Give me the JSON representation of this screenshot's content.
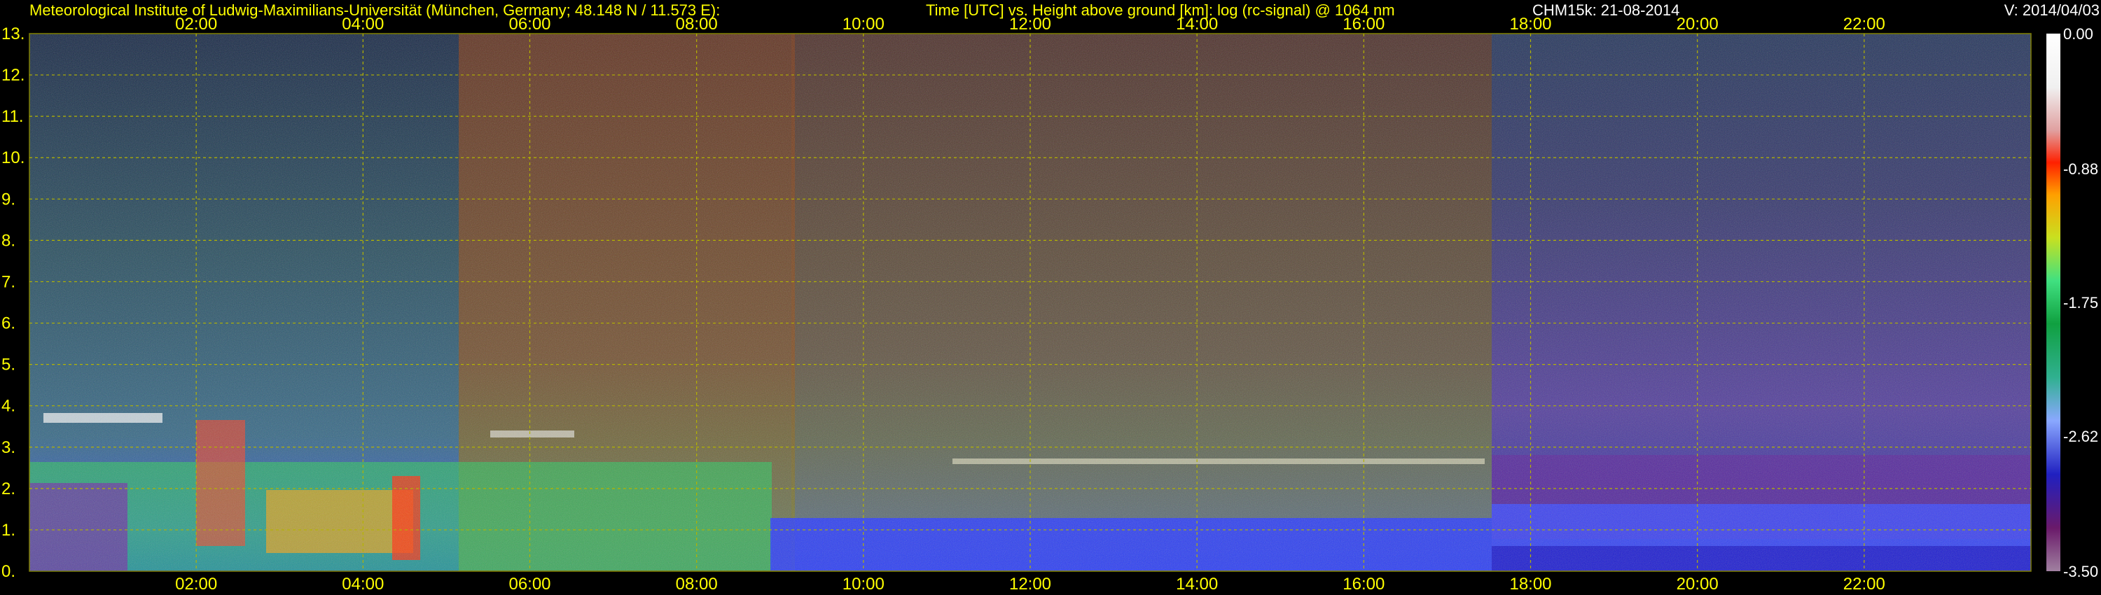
{
  "header": {
    "institute": "Meteorological Institute of Ludwig-Maximilians-Universität (München, Germany; 48.148 N / 11.573 E):",
    "description": "Time [UTC] vs. Height above ground [km]: log (rc-signal) @ 1064 nm",
    "instrument_date": "CHM15k: 21-08-2014",
    "version": "V: 2014/04/03"
  },
  "chart_data": {
    "type": "heatmap",
    "title": "Time [UTC] vs. Height above ground [km]: log (rc-signal) @ 1064 nm",
    "x_ticks": [
      "02:00",
      "04:00",
      "06:00",
      "08:00",
      "10:00",
      "12:00",
      "14:00",
      "16:00",
      "18:00",
      "20:00",
      "22:00"
    ],
    "x_tick_hours": [
      2,
      4,
      6,
      8,
      10,
      12,
      14,
      16,
      18,
      20,
      22
    ],
    "xlim_hours": [
      0,
      24
    ],
    "y_ticks": [
      "0.",
      "1.",
      "2.",
      "3.",
      "4.",
      "5.",
      "6.",
      "7.",
      "8.",
      "9.",
      "10.",
      "11.",
      "12.",
      "13."
    ],
    "y_tick_values": [
      0,
      1,
      2,
      3,
      4,
      5,
      6,
      7,
      8,
      9,
      10,
      11,
      12,
      13
    ],
    "ylim_km": [
      0,
      13
    ],
    "grid": true,
    "colorbar": {
      "range": [
        -3.5,
        0.0
      ],
      "tick_labels": [
        "0.00",
        "-0.88",
        "-1.75",
        "-2.62",
        "-3.50"
      ],
      "tick_values": [
        0.0,
        -0.88,
        -1.75,
        -2.62,
        -3.5
      ]
    },
    "colors": {
      "axis_text": "#ffff00",
      "grid": "#b4b400",
      "background": "#000000"
    }
  }
}
